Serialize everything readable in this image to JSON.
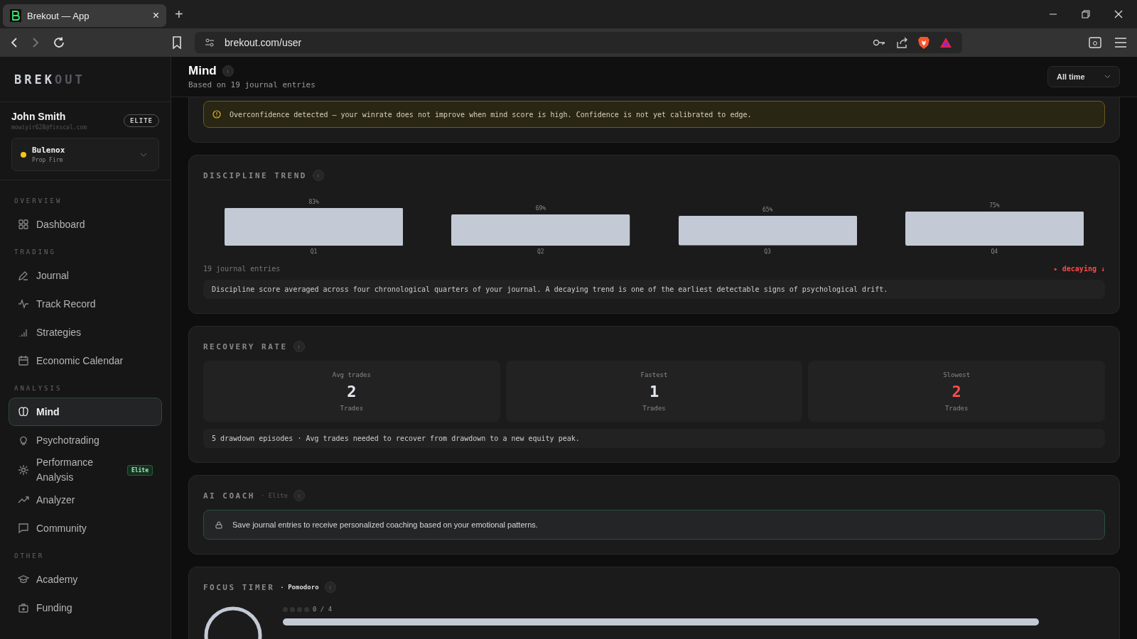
{
  "browser": {
    "tab_title": "Brekout — App",
    "tab_close": "×",
    "new_tab": "+",
    "url": "brekout.com/user"
  },
  "sidebar": {
    "logo_primary": "BREK",
    "logo_secondary": "OUT",
    "user": {
      "name": "John Smith",
      "email": "mowiyir628@fixscal.com",
      "badge": "ELITE"
    },
    "account": {
      "name": "Bulenox",
      "type": "Prop Firm",
      "color": "#f5c518"
    },
    "sections": [
      {
        "title": "OVERVIEW",
        "items": [
          {
            "label": "Dashboard",
            "selected": false
          }
        ]
      },
      {
        "title": "TRADING",
        "items": [
          {
            "label": "Journal",
            "selected": false
          },
          {
            "label": "Track Record",
            "selected": false
          },
          {
            "label": "Strategies",
            "selected": false
          },
          {
            "label": "Economic Calendar",
            "selected": false
          }
        ]
      },
      {
        "title": "ANALYSIS",
        "items": [
          {
            "label": "Mind",
            "selected": true
          },
          {
            "label": "Psychotrading",
            "selected": false
          },
          {
            "label": "Performance Analysis",
            "selected": false,
            "badge": "Elite"
          },
          {
            "label": "Analyzer",
            "selected": false
          },
          {
            "label": "Community",
            "selected": false
          }
        ]
      },
      {
        "title": "OTHER",
        "items": [
          {
            "label": "Academy",
            "selected": false
          },
          {
            "label": "Funding",
            "selected": false
          }
        ]
      }
    ]
  },
  "header": {
    "title": "Mind",
    "info": "i",
    "subtitle": "Based on 19 journal entries",
    "period": "All time"
  },
  "alert": {
    "text": "Overconfidence detected — your winrate does not improve when mind score is high. Confidence is not yet calibrated to edge."
  },
  "discipline": {
    "title": "DISCIPLINE TREND",
    "info": "i",
    "chart_data": {
      "type": "bar",
      "categories": [
        "Q1",
        "Q2",
        "Q3",
        "Q4"
      ],
      "values": [
        83,
        69,
        65,
        75
      ],
      "value_labels": [
        "83%",
        "69%",
        "65%",
        "75%"
      ]
    },
    "entries": "19 journal entries",
    "trend": {
      "label": "▸ decaying ↓",
      "decaying": true
    },
    "note": "Discipline score averaged across four chronological quarters of your journal. A decaying trend is one of the earliest detectable signs of psychological drift."
  },
  "recovery": {
    "title": "RECOVERY RATE",
    "info": "i",
    "stats": [
      {
        "label": "Avg trades",
        "value": "2",
        "unit": "Trades",
        "negative": false
      },
      {
        "label": "Fastest",
        "value": "1",
        "unit": "Trades",
        "negative": false
      },
      {
        "label": "Slowest",
        "value": "2",
        "unit": "Trades",
        "negative": true
      }
    ],
    "note": "5 drawdown episodes · Avg trades needed to recover from drawdown to a new equity peak."
  },
  "coach": {
    "title": "AI COACH",
    "tag": "· Elite",
    "info": "i",
    "message": "Save journal entries to receive personalized coaching based on your emotional patterns."
  },
  "focus": {
    "title": "FOCUS TIMER",
    "tag": "· Pomodoro",
    "info": "i",
    "sessions": [
      {
        "done": false
      },
      {
        "done": false
      },
      {
        "done": false
      },
      {
        "done": false
      }
    ],
    "count": "0 / 4"
  }
}
